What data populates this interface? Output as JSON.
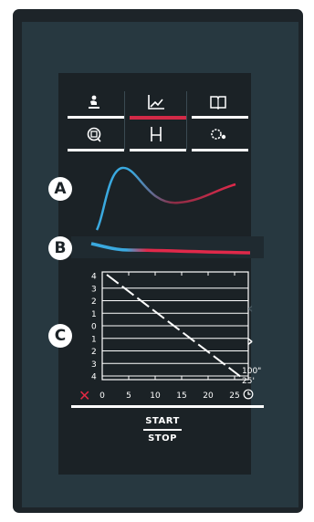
{
  "colors": {
    "accent_red": "#d22a47",
    "accent_blue": "#3aa9df",
    "panel_bg": "#1b2226",
    "screen_bg": "#273840"
  },
  "tabs": [
    {
      "icon": "chef-icon",
      "active": false
    },
    {
      "icon": "line-chart-icon",
      "active": true
    },
    {
      "icon": "book-icon",
      "active": false
    },
    {
      "icon": "pan-icon",
      "active": false
    },
    {
      "icon": "bracket-icon",
      "active": false
    },
    {
      "icon": "settings-icon",
      "active": false
    }
  ],
  "markers": {
    "a": "A",
    "b": "B",
    "c": "C"
  },
  "chart_c": {
    "y_ticks": [
      "4",
      "3",
      "2",
      "1",
      "0",
      "1",
      "2",
      "3",
      "4"
    ],
    "x_ticks": [
      "0",
      "5",
      "10",
      "15",
      "20",
      "25"
    ],
    "time_top": "100\"",
    "time_bottom": "25'"
  },
  "controls": {
    "next_arrow": "›",
    "prev_arrow": "‹",
    "close_mark": "✕",
    "start_label": "START",
    "stop_label": "STOP"
  }
}
